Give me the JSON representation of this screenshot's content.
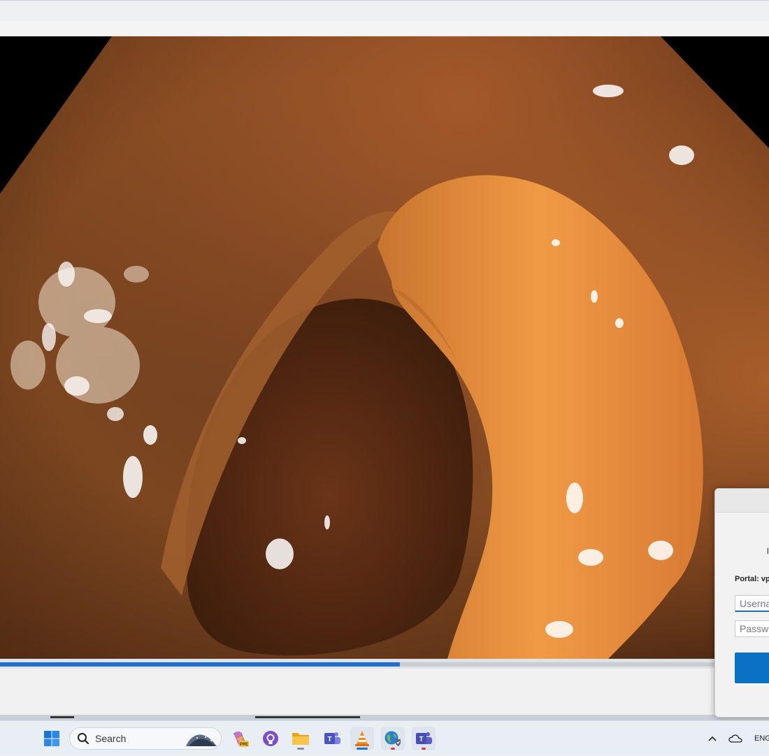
{
  "window": {
    "title": ""
  },
  "player": {
    "progress_fraction": 0.52
  },
  "dialog": {
    "heading": "l",
    "portal_label": "Portal: vp",
    "username_placeholder": "Userna",
    "password_placeholder": "Passwo",
    "connect_label": ""
  },
  "taskbar": {
    "search_placeholder": "Search",
    "apps": [
      {
        "name": "start"
      },
      {
        "name": "copilot",
        "badge": "PRE"
      },
      {
        "name": "github"
      },
      {
        "name": "file-explorer"
      },
      {
        "name": "teams-classic"
      },
      {
        "name": "vlc"
      },
      {
        "name": "globalprotect"
      },
      {
        "name": "teams"
      }
    ],
    "tray": {
      "language": "ENG"
    }
  },
  "colors": {
    "accent": "#1f6fd0",
    "connect_button": "#0a72c4",
    "taskbar_bg": "#e9eef5"
  }
}
